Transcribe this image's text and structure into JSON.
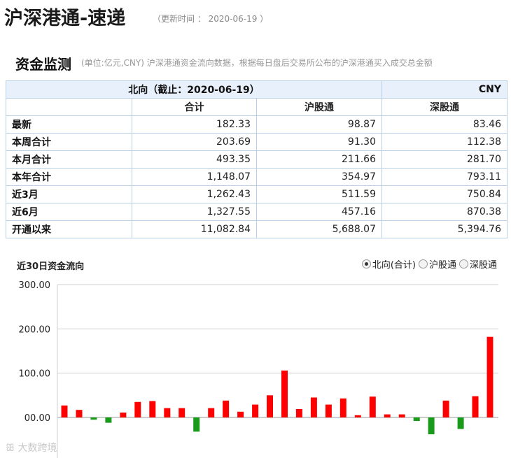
{
  "header": {
    "title": "沪深港通-速递",
    "update_label": "（更新时间 ：",
    "update_date": "2020-06-19",
    "update_close": "）"
  },
  "section": {
    "title": "资金监测",
    "description": "(单位:亿元,CNY)   沪深港通资金流向数据，根据每日盘后交易所公布的沪深港通买入成交总金额"
  },
  "table": {
    "header": "北向（截止：2020-06-19）",
    "currency": "CNY",
    "columns": [
      "",
      "合计",
      "沪股通",
      "深股通"
    ],
    "rows": [
      {
        "label": "最新",
        "total": "182.33",
        "sh": "98.87",
        "sz": "83.46"
      },
      {
        "label": "本周合计",
        "total": "203.69",
        "sh": "91.30",
        "sz": "112.38"
      },
      {
        "label": "本月合计",
        "total": "493.35",
        "sh": "211.66",
        "sz": "281.70"
      },
      {
        "label": "本年合计",
        "total": "1,148.07",
        "sh": "354.97",
        "sz": "793.11"
      },
      {
        "label": "近3月",
        "total": "1,262.43",
        "sh": "511.59",
        "sz": "750.84"
      },
      {
        "label": "近6月",
        "total": "1,327.55",
        "sh": "457.16",
        "sz": "870.38"
      },
      {
        "label": "开通以来",
        "total": "11,082.84",
        "sh": "5,688.07",
        "sz": "5,394.76"
      }
    ]
  },
  "flow": {
    "title": "近30日资金流向",
    "options": [
      {
        "label": "北向(合计)",
        "selected": true
      },
      {
        "label": "沪股通",
        "selected": false
      },
      {
        "label": "深股通",
        "selected": false
      }
    ]
  },
  "chart_data": {
    "type": "bar",
    "title": "",
    "xlabel": "",
    "ylabel": "",
    "ylim": [
      0,
      300
    ],
    "yticks": [
      "300.00",
      "200.00",
      "100.00",
      "00.00"
    ],
    "grid": true,
    "colors": {
      "positive": "#ff0000",
      "negative": "#1a9a1a"
    },
    "values": [
      27,
      17,
      -5,
      -12,
      11,
      35,
      37,
      21,
      21,
      -32,
      21,
      38,
      13,
      29,
      50,
      106,
      19,
      45,
      29,
      43,
      5,
      47,
      7,
      7,
      -8,
      -38,
      38,
      -26,
      48,
      182
    ]
  },
  "watermark": "大数跨境"
}
